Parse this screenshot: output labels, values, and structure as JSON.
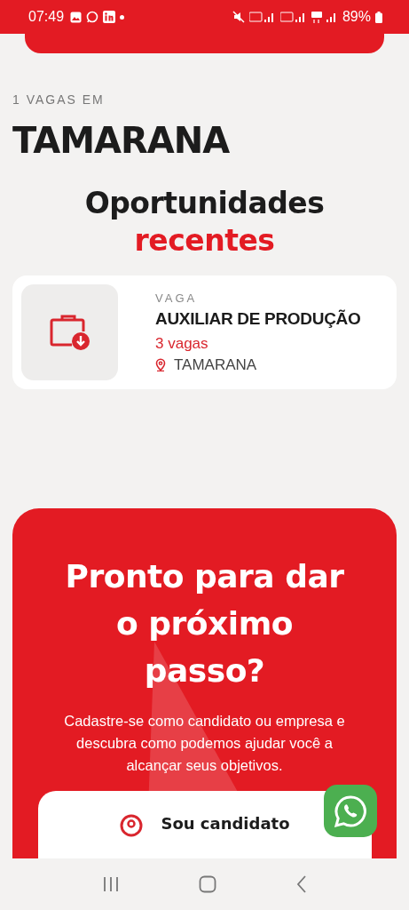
{
  "status_bar": {
    "time": "07:49",
    "battery": "89%"
  },
  "header": {
    "overline": "1 VAGAS EM",
    "city": "TAMARANA"
  },
  "section": {
    "title": "Oportunidades",
    "title_accent": "recentes"
  },
  "jobs": [
    {
      "overline": "VAGA",
      "title": "AUXILIAR DE PRODUÇÃO",
      "openings": "3 vagas",
      "location": "TAMARANA"
    }
  ],
  "cta": {
    "title": "Pronto para dar o próximo passo?",
    "text": "Cadastre-se como candidato ou empresa e descubra como podemos ajudar você a alcançar seus objetivos.",
    "options": [
      {
        "label": "Sou candidato"
      }
    ]
  }
}
